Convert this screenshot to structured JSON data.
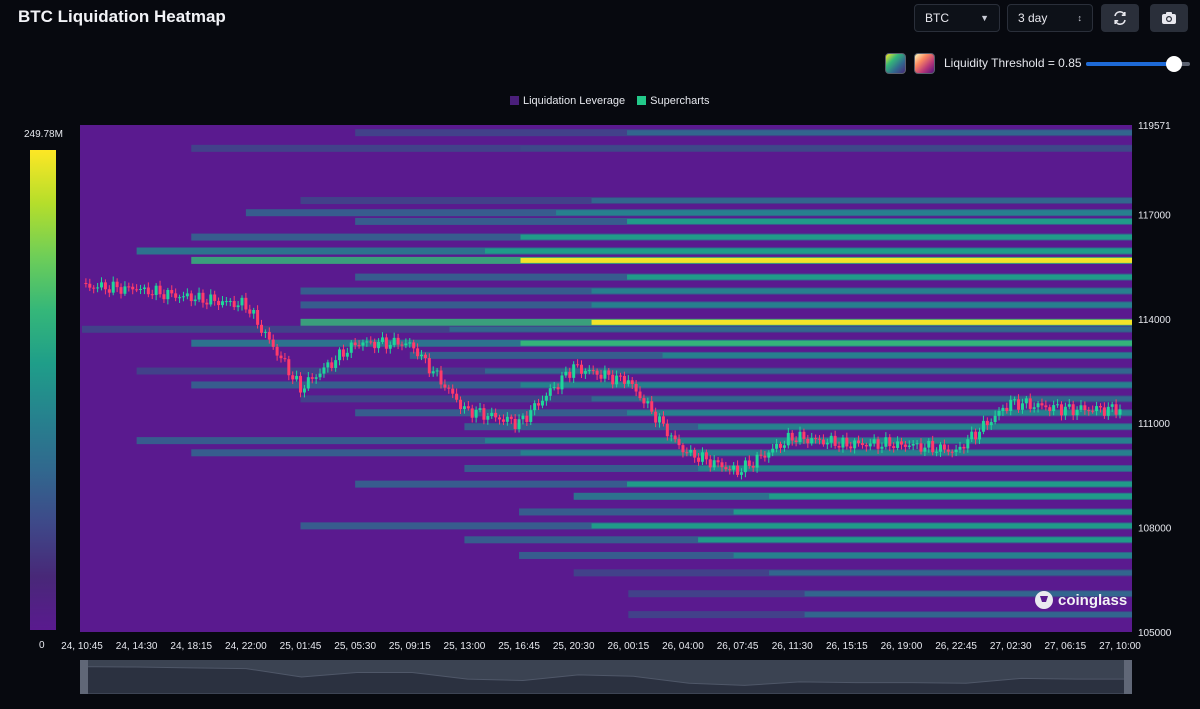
{
  "header": {
    "title": "BTC Liquidation Heatmap",
    "symbol_select": "BTC",
    "period_select": "3 day",
    "refresh_icon": "refresh-icon",
    "camera_icon": "camera-icon"
  },
  "threshold": {
    "label": "Liquidity Threshold = 0.85",
    "value": 0.85,
    "swatch_viridis": "viridis-palette",
    "swatch_magma": "magma-palette"
  },
  "legend": [
    {
      "label": "Liquidation Leverage",
      "color": "#4a1f7a"
    },
    {
      "label": "Supercharts",
      "color": "#23c98a"
    }
  ],
  "colorbar": {
    "max_label": "249.78M",
    "min_label": "0"
  },
  "watermark": "coinglass",
  "colors": {
    "background": "#5a1a8f",
    "candle_up": "#1fd69a",
    "candle_down": "#ff3b6b",
    "slider": "#1e6ad6"
  },
  "chart_data": {
    "type": "heatmap",
    "title": "BTC Liquidation Heatmap",
    "x_tick_labels": [
      "24, 10:45",
      "24, 14:30",
      "24, 18:15",
      "24, 22:00",
      "25, 01:45",
      "25, 05:30",
      "25, 09:15",
      "25, 13:00",
      "25, 16:45",
      "25, 20:30",
      "26, 00:15",
      "26, 04:00",
      "26, 07:45",
      "26, 11:30",
      "26, 15:15",
      "26, 19:00",
      "26, 22:45",
      "27, 02:30",
      "27, 06:15",
      "27, 10:00"
    ],
    "y_ticks": [
      119571,
      117000,
      114000,
      111000,
      108000,
      105000
    ],
    "ylim": [
      105000,
      119571
    ],
    "colorbar_range": [
      "0",
      "249.78M"
    ],
    "liquidity_bands": [
      {
        "price": 119350,
        "start": "25, 05:30",
        "intensity": 0.3
      },
      {
        "price": 118900,
        "start": "24, 18:15",
        "intensity": 0.25
      },
      {
        "price": 117400,
        "start": "25, 01:45",
        "intensity": 0.35
      },
      {
        "price": 117050,
        "start": "24, 22:00",
        "intensity": 0.45
      },
      {
        "price": 116800,
        "start": "25, 05:30",
        "intensity": 0.5
      },
      {
        "price": 116350,
        "start": "24, 18:15",
        "intensity": 0.55
      },
      {
        "price": 115950,
        "start": "24, 14:30",
        "intensity": 0.6
      },
      {
        "price": 115680,
        "start": "24, 18:15",
        "intensity": 0.95
      },
      {
        "price": 115200,
        "start": "25, 05:30",
        "intensity": 0.5
      },
      {
        "price": 114800,
        "start": "25, 01:45",
        "intensity": 0.4
      },
      {
        "price": 114400,
        "start": "25, 01:45",
        "intensity": 0.45
      },
      {
        "price": 113900,
        "start": "25, 01:45",
        "intensity": 0.95
      },
      {
        "price": 113700,
        "start": "24, 10:45",
        "intensity": 0.35
      },
      {
        "price": 113300,
        "start": "24, 18:15",
        "intensity": 0.7
      },
      {
        "price": 112950,
        "start": "25, 09:15",
        "intensity": 0.45
      },
      {
        "price": 112500,
        "start": "24, 14:30",
        "intensity": 0.35
      },
      {
        "price": 112100,
        "start": "24, 18:15",
        "intensity": 0.4
      },
      {
        "price": 111700,
        "start": "25, 01:45",
        "intensity": 0.35
      },
      {
        "price": 111300,
        "start": "25, 05:30",
        "intensity": 0.4
      },
      {
        "price": 110900,
        "start": "25, 13:00",
        "intensity": 0.4
      },
      {
        "price": 110500,
        "start": "24, 14:30",
        "intensity": 0.45
      },
      {
        "price": 110150,
        "start": "24, 18:15",
        "intensity": 0.4
      },
      {
        "price": 109700,
        "start": "25, 13:00",
        "intensity": 0.45
      },
      {
        "price": 109250,
        "start": "25, 05:30",
        "intensity": 0.55
      },
      {
        "price": 108900,
        "start": "25, 20:30",
        "intensity": 0.6
      },
      {
        "price": 108450,
        "start": "25, 16:45",
        "intensity": 0.55
      },
      {
        "price": 108050,
        "start": "25, 01:45",
        "intensity": 0.55
      },
      {
        "price": 107650,
        "start": "25, 13:00",
        "intensity": 0.5
      },
      {
        "price": 107200,
        "start": "25, 16:45",
        "intensity": 0.45
      },
      {
        "price": 106700,
        "start": "25, 20:30",
        "intensity": 0.35
      },
      {
        "price": 106100,
        "start": "26, 00:15",
        "intensity": 0.3
      },
      {
        "price": 105500,
        "start": "26, 00:15",
        "intensity": 0.3
      }
    ],
    "price_series": [
      {
        "t": "24, 10:45",
        "p": 114950
      },
      {
        "t": "24, 14:30",
        "p": 114850
      },
      {
        "t": "24, 18:15",
        "p": 114600
      },
      {
        "t": "24, 22:00",
        "p": 114400
      },
      {
        "t": "25, 01:45",
        "p": 112000
      },
      {
        "t": "25, 05:30",
        "p": 113300
      },
      {
        "t": "25, 09:15",
        "p": 113300
      },
      {
        "t": "25, 13:00",
        "p": 111400
      },
      {
        "t": "25, 16:45",
        "p": 111000
      },
      {
        "t": "25, 20:30",
        "p": 112600
      },
      {
        "t": "26, 00:15",
        "p": 112200
      },
      {
        "t": "26, 04:00",
        "p": 110200
      },
      {
        "t": "26, 07:45",
        "p": 109600
      },
      {
        "t": "26, 11:30",
        "p": 110600
      },
      {
        "t": "26, 15:15",
        "p": 110400
      },
      {
        "t": "26, 19:00",
        "p": 110400
      },
      {
        "t": "26, 22:45",
        "p": 110200
      },
      {
        "t": "27, 02:30",
        "p": 111600
      },
      {
        "t": "27, 06:15",
        "p": 111400
      },
      {
        "t": "27, 10:00",
        "p": 111400
      }
    ]
  }
}
